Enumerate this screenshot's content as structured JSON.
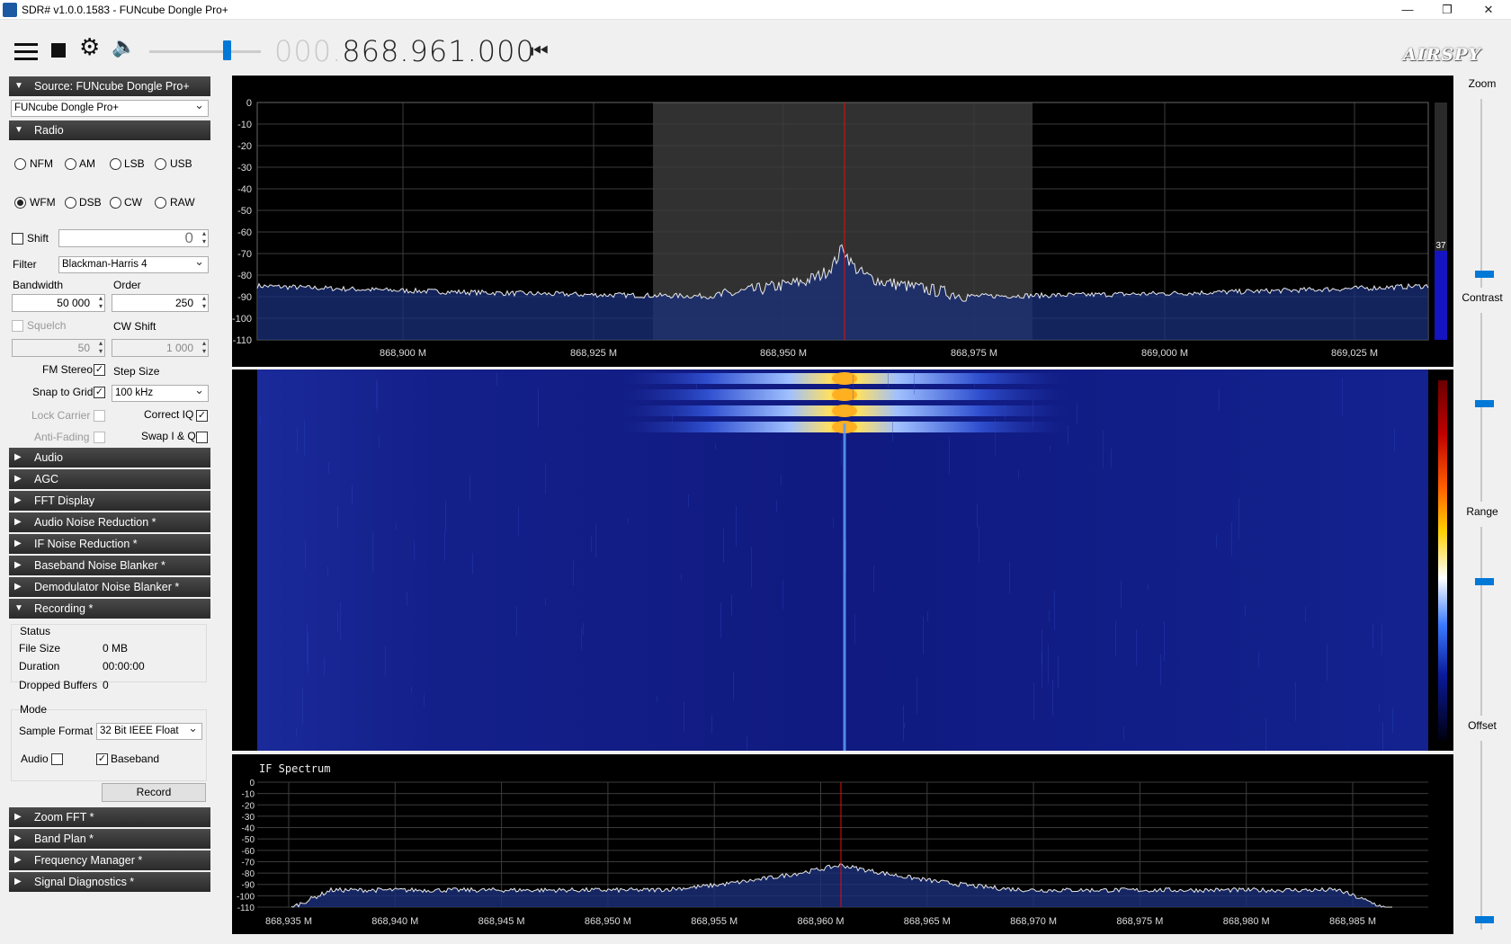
{
  "window": {
    "title": "SDR# v1.0.0.1583 - FUNcube Dongle Pro+",
    "minimize": "—",
    "restore": "❐",
    "close": "✕"
  },
  "toolbar": {
    "freq_dim": "000.",
    "freq_main": "868.961.000",
    "skip_glyph": "⏮",
    "logo": "AIRSPY",
    "volume_level": 0.6
  },
  "source": {
    "header": "Source: FUNcube Dongle Pro+",
    "device": "FUNcube Dongle Pro+"
  },
  "radio": {
    "header": "Radio",
    "modes": [
      "NFM",
      "AM",
      "LSB",
      "USB",
      "WFM",
      "DSB",
      "CW",
      "RAW"
    ],
    "selected_mode": "WFM",
    "shift_label": "Shift",
    "shift_value": "0",
    "filter_label": "Filter",
    "filter_value": "Blackman-Harris 4",
    "bandwidth_label": "Bandwidth",
    "bandwidth_value": "50 000",
    "order_label": "Order",
    "order_value": "250",
    "squelch_label": "Squelch",
    "squelch_value": "50",
    "cwshift_label": "CW Shift",
    "cwshift_value": "1 000",
    "fm_stereo_label": "FM Stereo",
    "step_size_label": "Step Size",
    "snap_label": "Snap to Grid",
    "step_value": "100 kHz",
    "lock_carrier_label": "Lock Carrier",
    "correct_iq_label": "Correct IQ",
    "anti_fading_label": "Anti-Fading",
    "swap_iq_label": "Swap I & Q"
  },
  "collapsed_panels": [
    "Audio",
    "AGC",
    "FFT Display",
    "Audio Noise Reduction *",
    "IF Noise Reduction *",
    "Baseband Noise Blanker *",
    "Demodulator Noise Blanker *"
  ],
  "recording": {
    "header": "Recording *",
    "status_title": "Status",
    "file_size_label": "File Size",
    "file_size": "0 MB",
    "duration_label": "Duration",
    "duration": "00:00:00",
    "dropped_label": "Dropped Buffers",
    "dropped": "0",
    "mode_title": "Mode",
    "sample_format_label": "Sample Format",
    "sample_format": "32 Bit IEEE Float",
    "audio_label": "Audio",
    "baseband_label": "Baseband",
    "record_button": "Record"
  },
  "lower_panels": [
    "Zoom FFT *",
    "Band Plan *",
    "Frequency Manager *",
    "Signal Diagnostics *"
  ],
  "right": {
    "zoom": "Zoom",
    "contrast": "Contrast",
    "range": "Range",
    "offset": "Offset"
  },
  "spectrum": {
    "y_ticks": [
      "0",
      "-10",
      "-20",
      "-30",
      "-40",
      "-50",
      "-60",
      "-70",
      "-80",
      "-90",
      "-100",
      "-110"
    ],
    "x_ticks": [
      "868,900 M",
      "868,925 M",
      "868,950 M",
      "868,975 M",
      "869,000 M",
      "869,025 M"
    ],
    "level_value": "37"
  },
  "if_spectrum": {
    "title": "IF Spectrum",
    "y_ticks": [
      "0",
      "-10",
      "-20",
      "-30",
      "-40",
      "-50",
      "-60",
      "-70",
      "-80",
      "-90",
      "-100",
      "-110"
    ],
    "x_ticks": [
      "868,935 M",
      "868,940 M",
      "868,945 M",
      "868,950 M",
      "868,955 M",
      "868,960 M",
      "868,965 M",
      "868,970 M",
      "868,975 M",
      "868,980 M",
      "868,985 M"
    ]
  }
}
